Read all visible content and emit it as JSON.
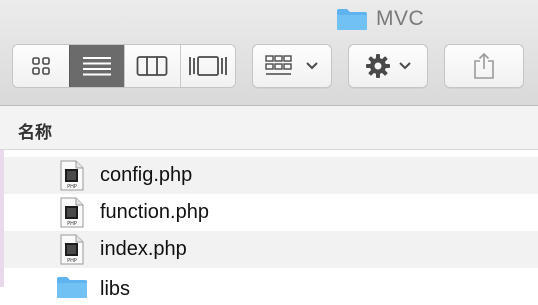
{
  "window": {
    "title": "MVC",
    "title_icon": "folder-icon",
    "accent_color": "#5fb4ef"
  },
  "toolbar": {
    "view_modes": [
      {
        "name": "icon-view",
        "icon": "grid-icon",
        "active": false
      },
      {
        "name": "list-view",
        "icon": "list-icon",
        "active": true
      },
      {
        "name": "column-view",
        "icon": "columns-icon",
        "active": false
      },
      {
        "name": "coverflow-view",
        "icon": "coverflow-icon",
        "active": false
      }
    ],
    "arrange_icon": "arrange-icon",
    "action_icon": "gear-icon",
    "share_icon": "share-icon"
  },
  "list": {
    "column_header": "名称",
    "files": [
      {
        "name": "config.php",
        "icon": "php-file-icon"
      },
      {
        "name": "function.php",
        "icon": "php-file-icon"
      },
      {
        "name": "index.php",
        "icon": "php-file-icon"
      },
      {
        "name": "libs",
        "icon": "folder-icon"
      }
    ],
    "file_icon_label": "PHP"
  }
}
